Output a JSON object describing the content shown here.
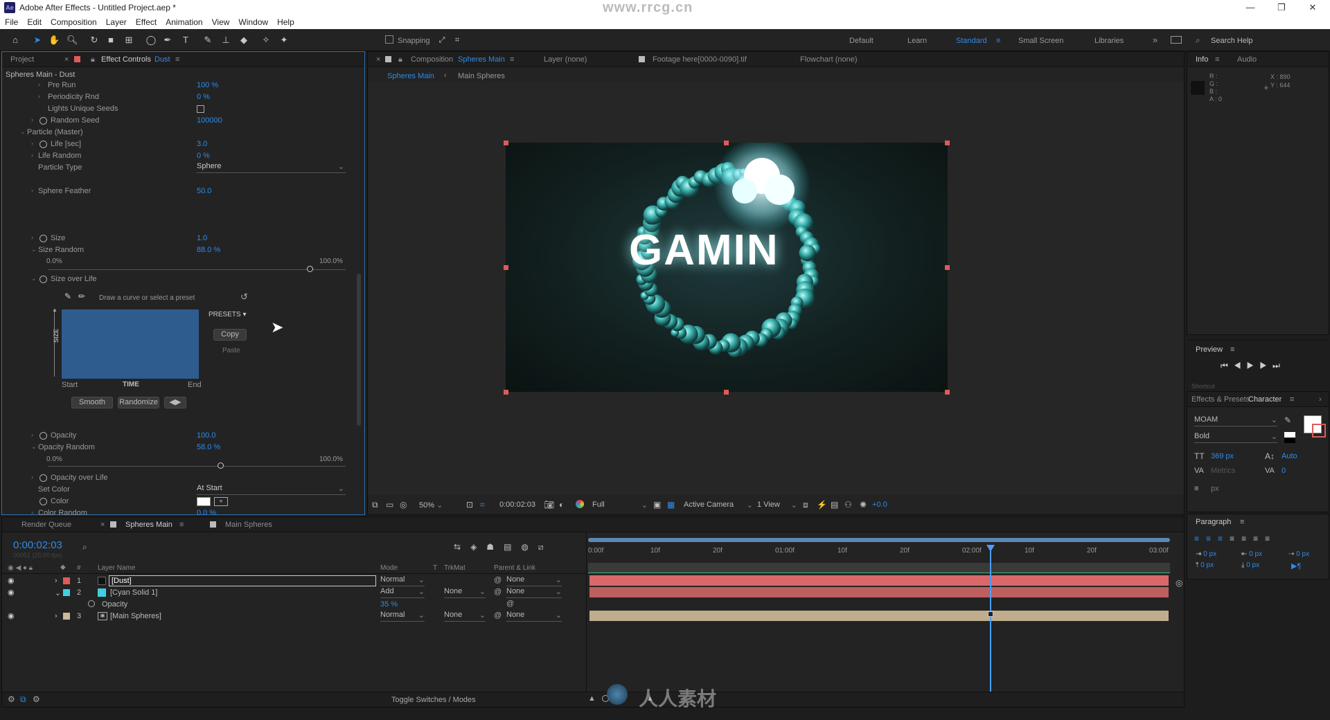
{
  "window": {
    "title": "Adobe After Effects - Untitled Project.aep *",
    "logo": "Ae",
    "watermark_top": "www.rrcg.cn"
  },
  "menu": [
    "File",
    "Edit",
    "Composition",
    "Layer",
    "Effect",
    "Animation",
    "View",
    "Window",
    "Help"
  ],
  "toolbar": {
    "snapping_label": "Snapping",
    "workspaces": [
      "Default",
      "Learn",
      "Standard",
      "Small Screen",
      "Libraries"
    ],
    "active_workspace": "Standard",
    "search_placeholder": "Search Help"
  },
  "effect_panel": {
    "tabs": {
      "project": "Project",
      "effect_controls": "Effect Controls",
      "layer": "Dust"
    },
    "header": "Spheres Main - Dust",
    "rows": [
      {
        "label": "Pre Run",
        "value": "100 %"
      },
      {
        "label": "Periodicity Rnd",
        "value": "0 %"
      },
      {
        "label": "Lights Unique Seeds",
        "value": ""
      },
      {
        "label": "Random Seed",
        "value": "100000"
      },
      {
        "label": "Particle (Master)",
        "value": ""
      },
      {
        "label": "Life [sec]",
        "value": "3.0"
      },
      {
        "label": "Life Random",
        "value": "0 %"
      },
      {
        "label": "Particle Type",
        "value": "Sphere"
      },
      {
        "label": "Sphere Feather",
        "value": "50.0"
      },
      {
        "label": "Size",
        "value": "1.0"
      },
      {
        "label": "Size Random",
        "value": "88.0 %"
      }
    ],
    "size_random_min": "0.0%",
    "size_random_max": "100.0%",
    "size_random_fraction": 0.88,
    "size_over_life": {
      "label": "Size over Life",
      "hint": "Draw a curve or select a preset",
      "presets": "PRESETS",
      "copy": "Copy",
      "paste": "Paste",
      "axis_y": "SIZE",
      "axis_x": "TIME",
      "start": "Start",
      "end": "End",
      "smooth": "Smooth",
      "randomize": "Randomize"
    },
    "rows2": [
      {
        "label": "Opacity",
        "value": "100.0"
      },
      {
        "label": "Opacity Random",
        "value": "58.0 %"
      }
    ],
    "opacity_random_min": "0.0%",
    "opacity_random_max": "100.0%",
    "opacity_random_fraction": 0.58,
    "rows3": [
      {
        "label": "Opacity over Life",
        "value": ""
      },
      {
        "label": "Set Color",
        "value": "At Start"
      },
      {
        "label": "Color",
        "value": ""
      },
      {
        "label": "Color Random",
        "value": "0.0 %"
      }
    ]
  },
  "comp_panel": {
    "tabs": {
      "composition_prefix": "Composition",
      "composition": "Spheres Main",
      "layer": "Layer (none)",
      "footage": "Footage here[0000-0090].tif",
      "flowchart": "Flowchart (none)"
    },
    "breadcrumbs": [
      "Spheres Main",
      "Main Spheres"
    ],
    "preview_text": "GAMIN",
    "footer": {
      "zoom": "50%",
      "timecode": "0:00:02:03",
      "resolution": "Full",
      "camera": "Active Camera",
      "view": "1 View",
      "exposure": "+0.0"
    }
  },
  "info_panel": {
    "tabs": [
      "Info",
      "Audio"
    ],
    "rgb": [
      "R :",
      "G :",
      "B :",
      "A : 0"
    ],
    "coords": [
      "X : 890",
      "Y : 644"
    ]
  },
  "preview_panel": {
    "title": "Preview",
    "sub": "Shortcut"
  },
  "character_panel": {
    "tabs": [
      "Effects & Presets",
      "Character"
    ],
    "font": "MOAM",
    "style": "Bold",
    "size": "369 px",
    "leading": "Auto",
    "kerning": "Metrics",
    "tracking": "0",
    "unit": "px"
  },
  "paragraph_panel": {
    "title": "Paragraph",
    "indent": [
      "0 px",
      "0 px",
      "0 px",
      "0 px",
      "0 px"
    ]
  },
  "timeline": {
    "tabs": [
      "Render Queue",
      "Spheres Main",
      "Main Spheres"
    ],
    "timecode": "0:00:02:03",
    "frame_info": "00051 (25.00 fps)",
    "columns": {
      "name": "Layer Name",
      "mode": "Mode",
      "t": "T",
      "trkmat": "TrkMat",
      "parent": "Parent & Link"
    },
    "layers": [
      {
        "num": "1",
        "name": "[Dust]",
        "mode": "Normal",
        "trkmat": "",
        "parent": "None",
        "color": "#e05a5a",
        "selected": true
      },
      {
        "num": "2",
        "name": "[Cyan Solid 1]",
        "mode": "Add",
        "trkmat": "None",
        "parent": "None",
        "color": "#3fd0e0",
        "selected": false
      },
      {
        "num": "3",
        "name": "[Main Spheres]",
        "mode": "Normal",
        "trkmat": "None",
        "parent": "None",
        "color": "#cdb99a",
        "selected": false
      }
    ],
    "opacity_label": "Opacity",
    "opacity_value": "35 %",
    "ruler": [
      "0:00f",
      "10f",
      "20f",
      "01:00f",
      "10f",
      "20f",
      "02:00f",
      "10f",
      "20f",
      "03:00f"
    ],
    "playhead_fraction": 0.69,
    "toggle_label": "Toggle Switches / Modes",
    "watermark_bottom": "人人素材"
  },
  "colors": {
    "accent": "#2d8ceb",
    "layer_red": "#d9686a",
    "layer_tan": "#c0ad8e",
    "playhead": "#4a9eff",
    "handle": "#e05a5a"
  }
}
